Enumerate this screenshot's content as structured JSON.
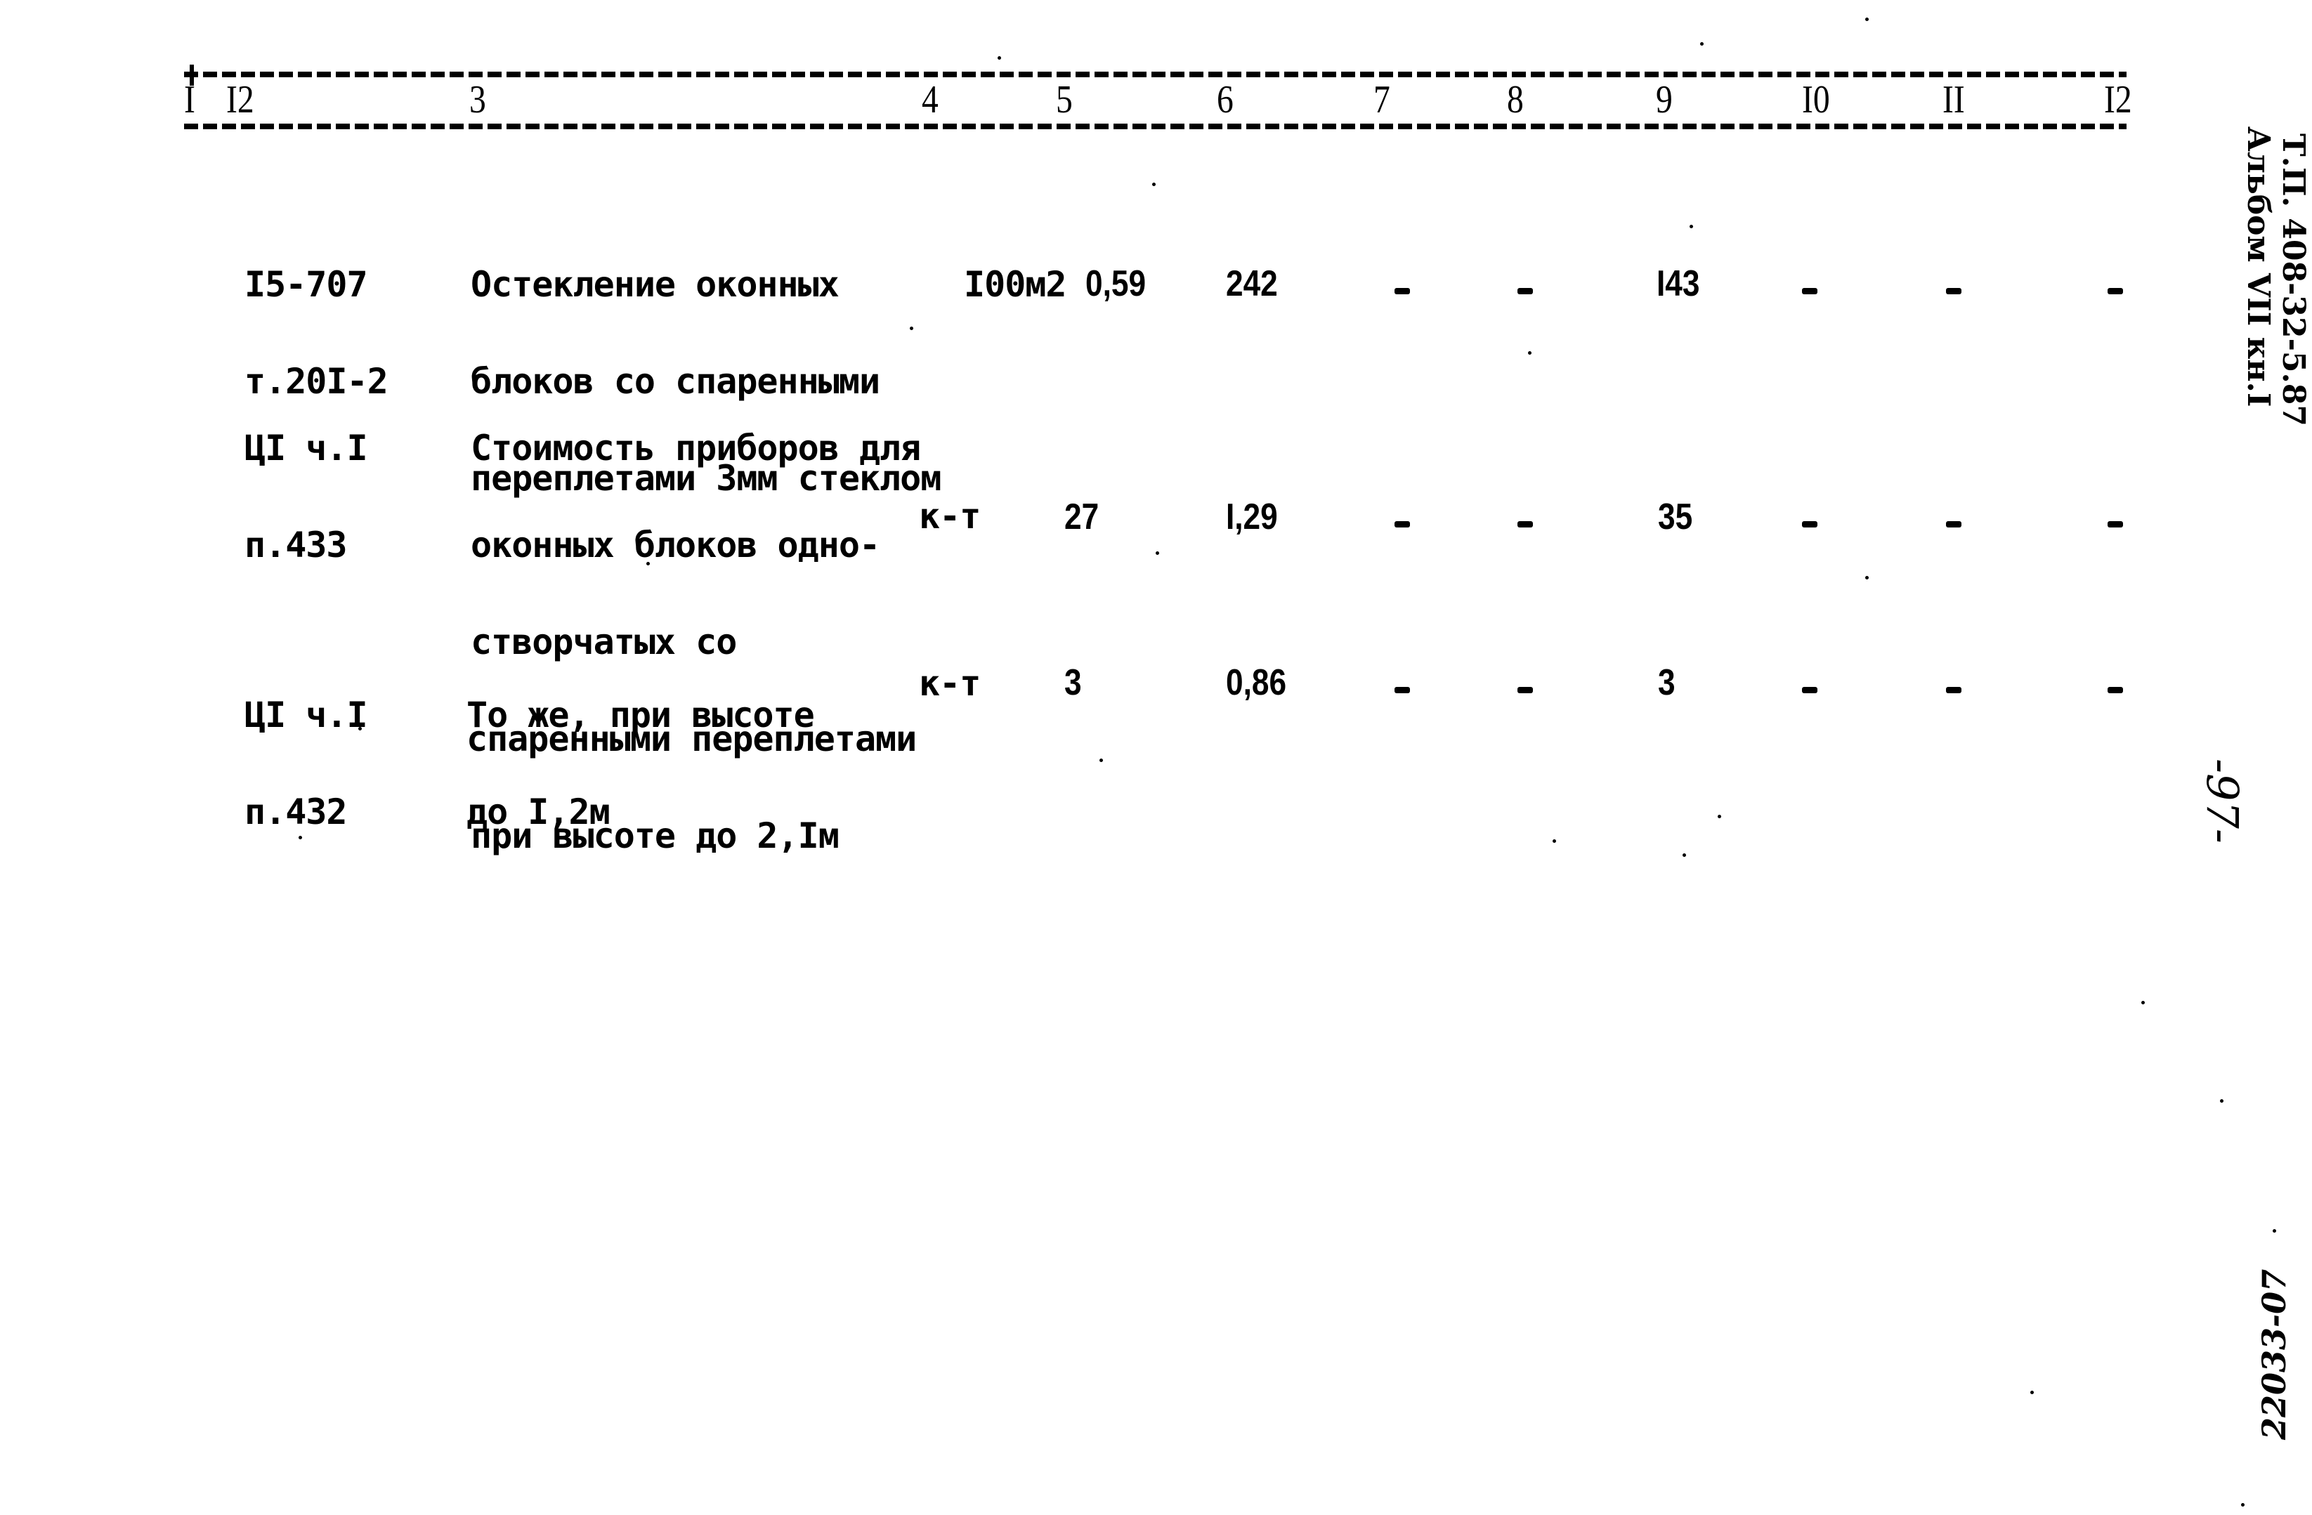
{
  "table_header": {
    "columns": [
      "I",
      "I2",
      "3",
      "4",
      "5",
      "6",
      "7",
      "8",
      "9",
      "I0",
      "II",
      "I2"
    ]
  },
  "rows": [
    {
      "code": [
        "I5-707",
        "т.20I-2"
      ],
      "description": [
        "Остекление оконных",
        "блоков со спаренными",
        "переплетами 3мм стеклом"
      ],
      "unit": "I00м2",
      "quantity": "0,59",
      "col6": "242",
      "col7": "-",
      "col8": "-",
      "col9": "I43",
      "col10": "-",
      "col11": "-",
      "col12": "-"
    },
    {
      "code": [
        "ЦI ч.I",
        "п.433"
      ],
      "description": [
        "Стоимость приборов для",
        "оконных блоков одно-",
        "створчатых со",
        "спаренными переплетами",
        "при высоте до 2,Iм"
      ],
      "unit": "к-т",
      "quantity": "27",
      "col6": "I,29",
      "col7": "-",
      "col8": "-",
      "col9": "35",
      "col10": "-",
      "col11": "-",
      "col12": "-"
    },
    {
      "code": [
        "ЦI ч.I",
        "п.432"
      ],
      "description": [
        "То же, при высоте",
        "до I,2м"
      ],
      "unit": "к-т",
      "quantity": "3",
      "col6": "0,86",
      "col7": "-",
      "col8": "-",
      "col9": "3",
      "col10": "-",
      "col11": "-",
      "col12": "-"
    }
  ],
  "margin_notes": {
    "project_code": "Т.П. 408-32-5.87",
    "album": "Альбом VII кн.I",
    "page_number": "-97-",
    "archive_number": "22033-07"
  }
}
